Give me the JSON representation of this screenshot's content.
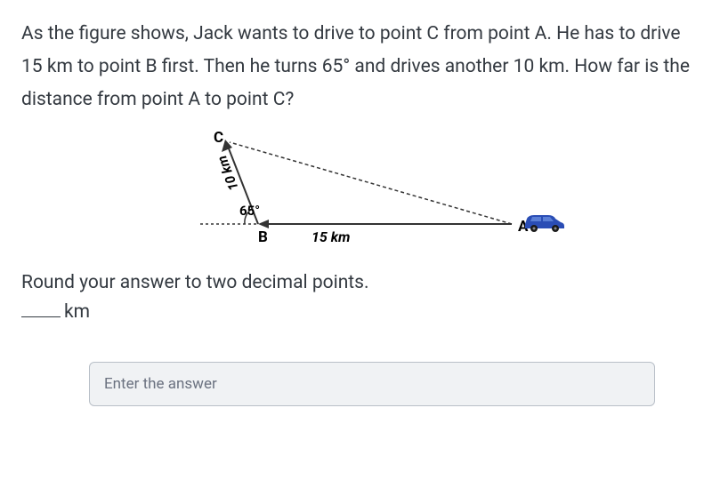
{
  "problem": {
    "text": "As the figure shows, Jack wants to drive to point C from point A. He has to drive 15 km to point B first. Then he turns 65° and drives another 10 km. How far is the distance from point A to point C?"
  },
  "figure": {
    "point_c": "C",
    "point_b": "B",
    "point_a": "A",
    "side_bc": "10 km",
    "side_ab": "15 km",
    "angle": "65°"
  },
  "instruction": "Round your answer to two decimal points.",
  "answer_unit": "km",
  "input": {
    "placeholder": "Enter the answer"
  }
}
